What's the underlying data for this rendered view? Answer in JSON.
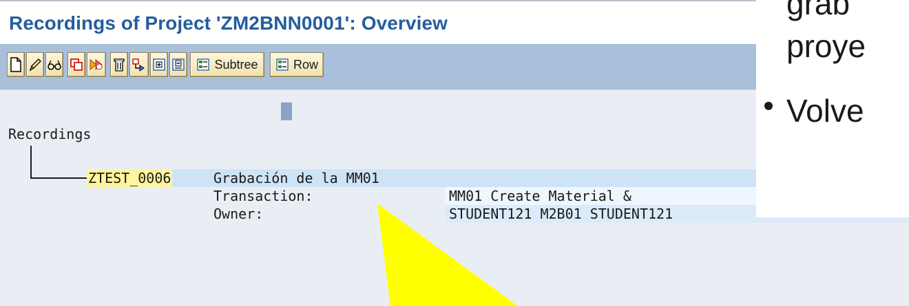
{
  "header": {
    "title": "Recordings of Project 'ZM2BNN0001': Overview"
  },
  "toolbar": {
    "buttons": [
      {
        "icon": "new-document-icon"
      },
      {
        "icon": "edit-pencil-icon"
      },
      {
        "icon": "display-glasses-icon"
      },
      {
        "icon": "copy-icon"
      },
      {
        "icon": "execute-icon"
      },
      {
        "icon": "delete-trash-icon"
      },
      {
        "icon": "navigate-icon"
      },
      {
        "icon": "expand-icon"
      },
      {
        "icon": "collapse-icon"
      }
    ],
    "subtree_label": "Subtree",
    "row_label": "Row"
  },
  "tree": {
    "root_label": "Recordings",
    "recording": {
      "id": "ZTEST_0006",
      "description": "Grabación de la MM01",
      "transaction_label": "Transaction:",
      "transaction_value": "MM01 Create Material &",
      "owner_label": "Owner:",
      "owner_value": "STUDENT121 M2B01 STUDENT121"
    }
  },
  "slide_overlay": {
    "line1": "grab",
    "line2": "proye",
    "line3": "Volve"
  },
  "colors": {
    "title": "#245d9c",
    "toolbar_bg": "#a9c0da",
    "content_bg": "#e9eef4",
    "id_highlight": "#fff59d",
    "row_highlight": "#cfe3f7",
    "arrow": "#ffff00"
  }
}
